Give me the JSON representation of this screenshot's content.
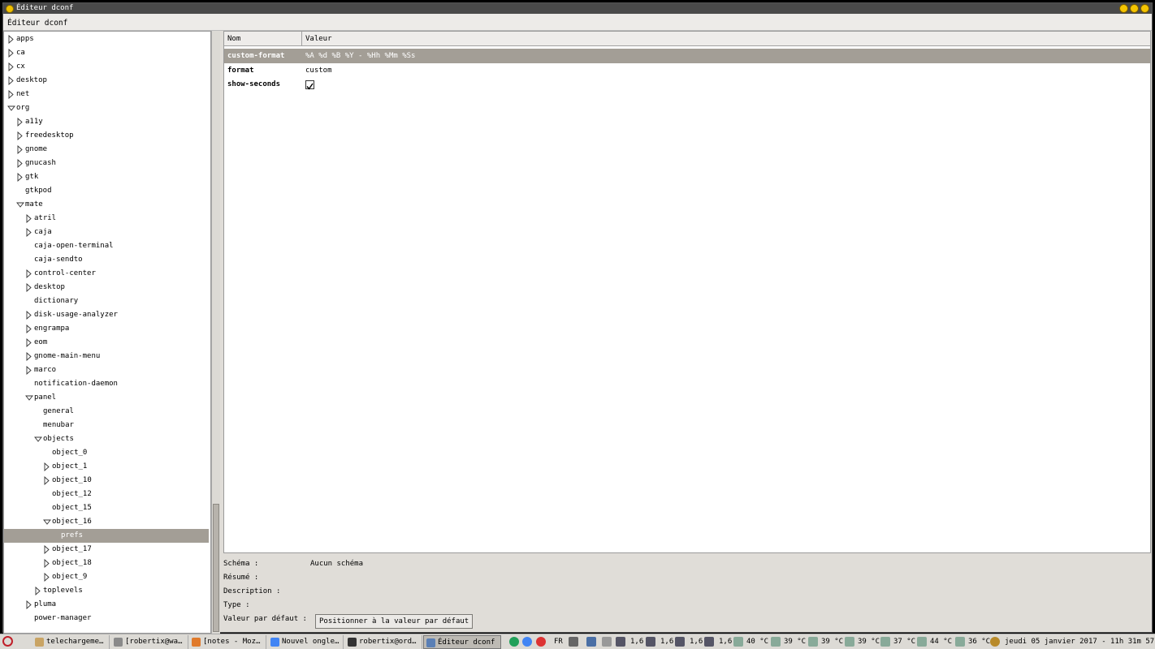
{
  "window": {
    "title": "Éditeur dconf"
  },
  "menubar": {
    "app_label": "Éditeur dconf"
  },
  "tree": [
    {
      "label": "apps",
      "depth": 0,
      "arrow": "right"
    },
    {
      "label": "ca",
      "depth": 0,
      "arrow": "right"
    },
    {
      "label": "cx",
      "depth": 0,
      "arrow": "right"
    },
    {
      "label": "desktop",
      "depth": 0,
      "arrow": "right"
    },
    {
      "label": "net",
      "depth": 0,
      "arrow": "right"
    },
    {
      "label": "org",
      "depth": 0,
      "arrow": "down"
    },
    {
      "label": "a11y",
      "depth": 1,
      "arrow": "right"
    },
    {
      "label": "freedesktop",
      "depth": 1,
      "arrow": "right"
    },
    {
      "label": "gnome",
      "depth": 1,
      "arrow": "right"
    },
    {
      "label": "gnucash",
      "depth": 1,
      "arrow": "right"
    },
    {
      "label": "gtk",
      "depth": 1,
      "arrow": "right"
    },
    {
      "label": "gtkpod",
      "depth": 1,
      "arrow": "none"
    },
    {
      "label": "mate",
      "depth": 1,
      "arrow": "down"
    },
    {
      "label": "atril",
      "depth": 2,
      "arrow": "right"
    },
    {
      "label": "caja",
      "depth": 2,
      "arrow": "right"
    },
    {
      "label": "caja-open-terminal",
      "depth": 2,
      "arrow": "none"
    },
    {
      "label": "caja-sendto",
      "depth": 2,
      "arrow": "none"
    },
    {
      "label": "control-center",
      "depth": 2,
      "arrow": "right"
    },
    {
      "label": "desktop",
      "depth": 2,
      "arrow": "right"
    },
    {
      "label": "dictionary",
      "depth": 2,
      "arrow": "none"
    },
    {
      "label": "disk-usage-analyzer",
      "depth": 2,
      "arrow": "right"
    },
    {
      "label": "engrampa",
      "depth": 2,
      "arrow": "right"
    },
    {
      "label": "eom",
      "depth": 2,
      "arrow": "right"
    },
    {
      "label": "gnome-main-menu",
      "depth": 2,
      "arrow": "right"
    },
    {
      "label": "marco",
      "depth": 2,
      "arrow": "right"
    },
    {
      "label": "notification-daemon",
      "depth": 2,
      "arrow": "none"
    },
    {
      "label": "panel",
      "depth": 2,
      "arrow": "down"
    },
    {
      "label": "general",
      "depth": 3,
      "arrow": "none"
    },
    {
      "label": "menubar",
      "depth": 3,
      "arrow": "none"
    },
    {
      "label": "objects",
      "depth": 3,
      "arrow": "down"
    },
    {
      "label": "object_0",
      "depth": 4,
      "arrow": "none"
    },
    {
      "label": "object_1",
      "depth": 4,
      "arrow": "right"
    },
    {
      "label": "object_10",
      "depth": 4,
      "arrow": "right"
    },
    {
      "label": "object_12",
      "depth": 4,
      "arrow": "none"
    },
    {
      "label": "object_15",
      "depth": 4,
      "arrow": "none"
    },
    {
      "label": "object_16",
      "depth": 4,
      "arrow": "down"
    },
    {
      "label": "prefs",
      "depth": 5,
      "arrow": "none",
      "selected": true
    },
    {
      "label": "object_17",
      "depth": 4,
      "arrow": "right"
    },
    {
      "label": "object_18",
      "depth": 4,
      "arrow": "right"
    },
    {
      "label": "object_9",
      "depth": 4,
      "arrow": "right"
    },
    {
      "label": "toplevels",
      "depth": 3,
      "arrow": "right"
    },
    {
      "label": "pluma",
      "depth": 2,
      "arrow": "right"
    },
    {
      "label": "power-manager",
      "depth": 2,
      "arrow": "none"
    }
  ],
  "table": {
    "col_name": "Nom",
    "col_value": "Valeur",
    "rows": [
      {
        "name": "custom-format",
        "value": "%A %d %B %Y - %Hh %Mm %Ss",
        "selected": true
      },
      {
        "name": "format",
        "value": "custom"
      },
      {
        "name": "show-seconds",
        "value": "",
        "checkbox": true,
        "checked": true
      }
    ]
  },
  "info": {
    "schema_label": "Schéma :",
    "schema_value": "Aucun schéma",
    "summary_label": "Résumé :",
    "description_label": "Description :",
    "type_label": "Type :",
    "default_label": "Valeur par défaut :",
    "reset_button": "Positionner à la valeur par défaut"
  },
  "taskbar": {
    "tasks": [
      {
        "label": "telechargeme…",
        "icon_color": "#c9a464",
        "icon": "folder-icon"
      },
      {
        "label": "[robertix@wa…",
        "icon_color": "#8a8a8a",
        "icon": "terminal-icon"
      },
      {
        "label": "[notes - Moz…",
        "icon_color": "#e07a2b",
        "icon": "firefox-icon"
      },
      {
        "label": "Nouvel ongle…",
        "icon_color": "#4285f4",
        "icon": "chrome-icon"
      },
      {
        "label": "robertix@ord…",
        "icon_color": "#333333",
        "icon": "terminal-icon"
      },
      {
        "label": "Éditeur dconf",
        "icon_color": "#5a7fb5",
        "icon": "dconf-icon",
        "active": true
      }
    ],
    "keyboard_layout": "FR",
    "cpu_freqs": [
      "1,6",
      "1,6",
      "1,6",
      "1,6"
    ],
    "temps": [
      "40 °C",
      "39 °C",
      "39 °C",
      "39 °C",
      "37 °C",
      "44 °C",
      "36 °C"
    ],
    "clock": "jeudi 05 janvier 2017 - 11h 31m 57s"
  }
}
